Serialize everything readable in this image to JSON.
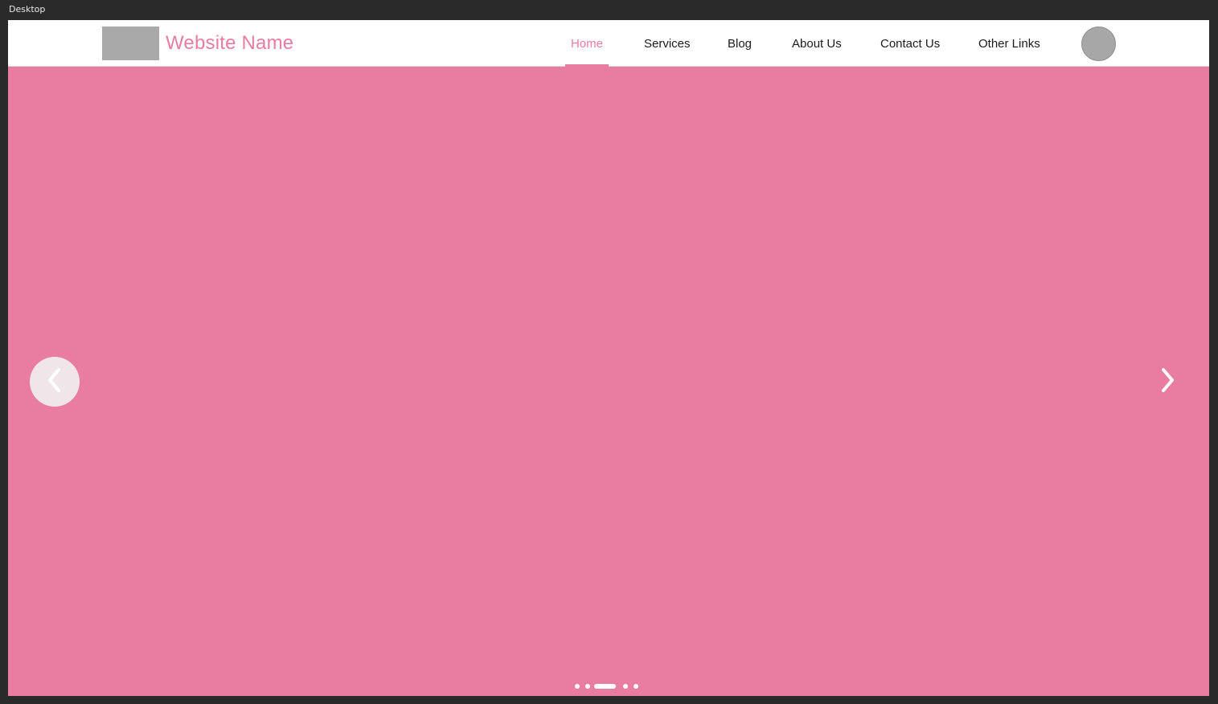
{
  "window": {
    "label": "Desktop"
  },
  "header": {
    "site_name": "Website Name",
    "nav": [
      {
        "label": "Home",
        "active": true
      },
      {
        "label": "Services",
        "active": false
      },
      {
        "label": "Blog",
        "active": false
      },
      {
        "label": "About Us",
        "active": false
      },
      {
        "label": "Contact Us",
        "active": false
      },
      {
        "label": "Other Links",
        "active": false
      }
    ]
  },
  "carousel": {
    "slide_count": 5,
    "active_slide": 3,
    "prev_icon": "chevron-left-icon",
    "next_icon": "chevron-right-icon"
  },
  "colors": {
    "accent": "#e87ca1",
    "placeholder_gray": "#a9a9a9",
    "header_bg": "#ffffff",
    "canvas_bg": "#2a2a2a"
  }
}
